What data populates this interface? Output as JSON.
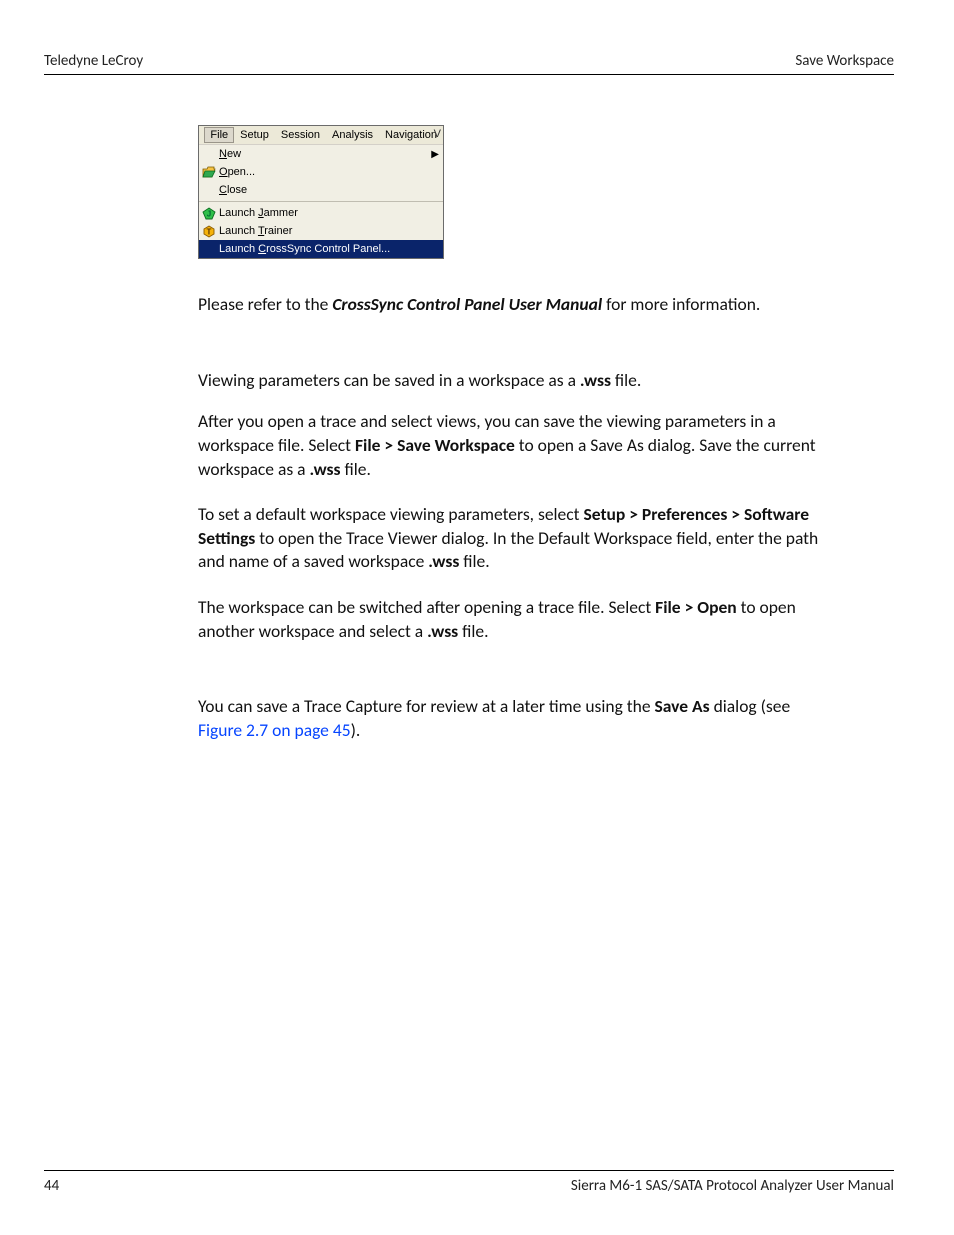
{
  "header": {
    "left": "Teledyne LeCroy",
    "right": "Save Workspace"
  },
  "menubar": {
    "items": [
      "File",
      "Setup",
      "Session",
      "Analysis",
      "Navigation"
    ],
    "clipped": "V"
  },
  "dropdown": {
    "items": [
      {
        "label_pre": "",
        "label_u": "N",
        "label_post": "ew",
        "icon": "none",
        "arrow": true,
        "hl": false
      },
      {
        "label_pre": "",
        "label_u": "O",
        "label_post": "pen...",
        "icon": "open",
        "arrow": false,
        "hl": false
      },
      {
        "label_pre": "",
        "label_u": "C",
        "label_post": "lose",
        "icon": "none",
        "arrow": false,
        "hl": false
      }
    ],
    "items2": [
      {
        "label_pre": "Launch ",
        "label_u": "J",
        "label_post": "ammer",
        "icon": "jammer",
        "arrow": false,
        "hl": false
      },
      {
        "label_pre": "Launch ",
        "label_u": "T",
        "label_post": "rainer",
        "icon": "trainer",
        "arrow": false,
        "hl": false
      },
      {
        "label_pre": "Launch ",
        "label_u": "C",
        "label_post": "rossSync Control Panel...",
        "icon": "none",
        "arrow": false,
        "hl": true
      }
    ]
  },
  "body": {
    "p1_a": "Please refer to the ",
    "p1_b": "CrossSync Control Panel User Manual",
    "p1_c": " for more information.",
    "p2_a": "Viewing parameters can be saved in a workspace as a ",
    "p2_b": ".wss",
    "p2_c": " file.",
    "p3_a": "After you open a trace and select views, you can save the viewing parameters in a workspace file. Select ",
    "p3_b": "File > Save Workspace",
    "p3_c": " to open a Save As dialog. Save the current workspace as a ",
    "p3_d": ".wss",
    "p3_e": " file.",
    "p4_a": "To set a default workspace viewing parameters, select ",
    "p4_b": "Setup > Preferences > Software Settings",
    "p4_c": " to open the Trace Viewer dialog. In the Default Workspace field, enter the path and name of a saved workspace ",
    "p4_d": ".wss",
    "p4_e": " file.",
    "p5_a": "The workspace can be switched after opening a trace file. Select ",
    "p5_b": "File > Open",
    "p5_c": " to open another workspace and select a ",
    "p5_d": ".wss",
    "p5_e": " file.",
    "p6_a": "You can save a Trace Capture for review at a later time using the ",
    "p6_b": "Save As",
    "p6_c": " dialog (see ",
    "p6_link": "Figure 2.7 on page 45",
    "p6_d": ")."
  },
  "footer": {
    "page": "44",
    "title": "Sierra M6-1 SAS/SATA Protocol Analyzer User Manual"
  }
}
